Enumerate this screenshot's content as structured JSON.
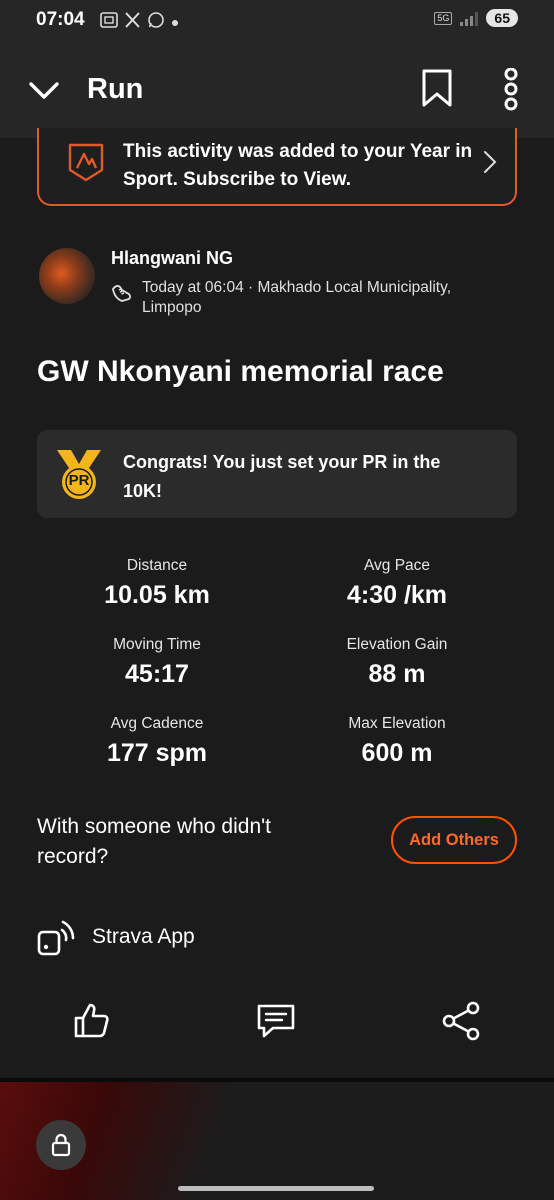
{
  "status_bar": {
    "time": "07:04",
    "network": "5G",
    "battery": "65",
    "icons": [
      "screenshot-icon",
      "x-icon",
      "whatsapp-icon",
      "dot-icon"
    ]
  },
  "app_bar": {
    "title": "Run"
  },
  "banner": {
    "text": "This activity was added to your Year in Sport. Subscribe to View.",
    "accent_color": "#e4582a"
  },
  "athlete": {
    "name": "Hlangwani NG",
    "meta": "Today at 06:04 · Makhado Local Municipality, Limpopo"
  },
  "activity": {
    "title": "GW Nkonyani memorial race"
  },
  "pr_card": {
    "badge": "PR",
    "text": "Congrats! You just set your PR in the 10K!",
    "medal_color": "#f3b51a"
  },
  "stats": {
    "distance": {
      "label": "Distance",
      "value": "10.05 km"
    },
    "avg_pace": {
      "label": "Avg Pace",
      "value": "4:30 /km"
    },
    "moving_time": {
      "label": "Moving Time",
      "value": "45:17"
    },
    "elevation_gain": {
      "label": "Elevation Gain",
      "value": "88 m"
    },
    "avg_cadence": {
      "label": "Avg Cadence",
      "value": "177 spm"
    },
    "max_elevation": {
      "label": "Max Elevation",
      "value": "600 m"
    }
  },
  "with_others": {
    "prompt": "With someone who didn't record?",
    "button": "Add Others",
    "button_color": "#fc5200"
  },
  "device": {
    "name": "Strava App"
  },
  "actions": [
    "like-icon",
    "comment-icon",
    "share-icon"
  ]
}
